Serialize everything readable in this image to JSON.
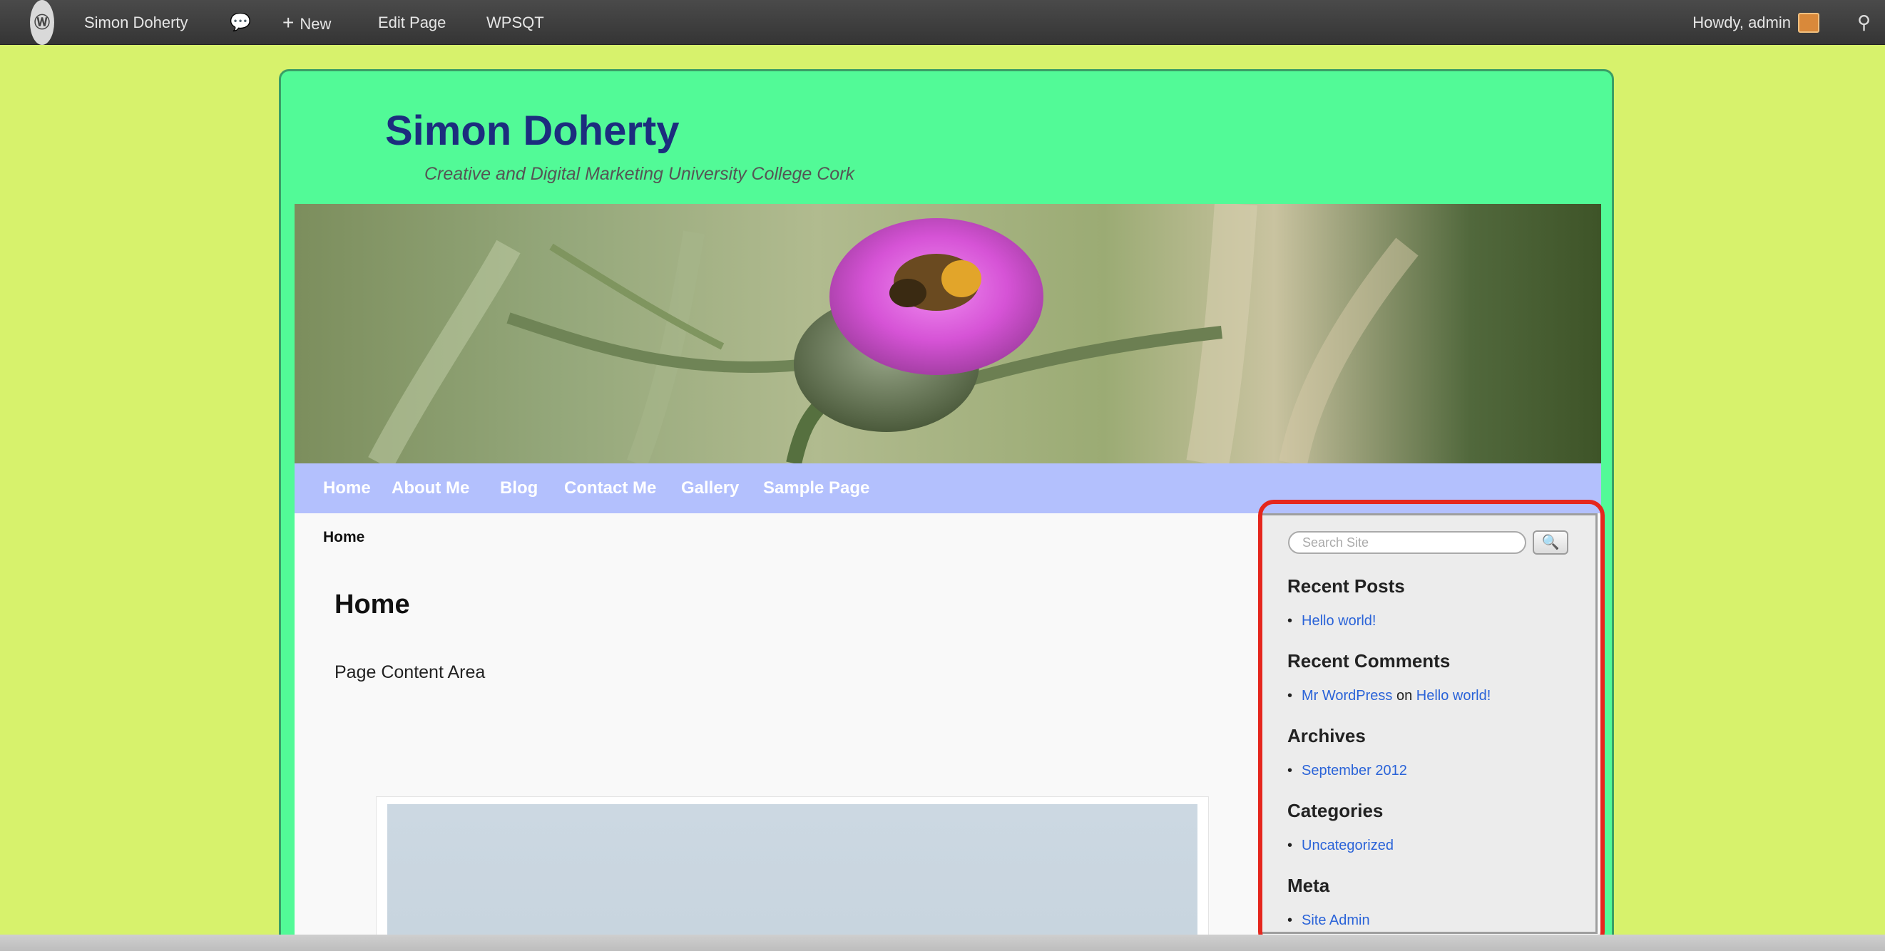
{
  "admin_bar": {
    "logo": "Ⓦ",
    "site_name": "Simon Doherty",
    "comments_icon": "💬",
    "new_label": "New",
    "new_plus": "+",
    "edit_page": "Edit Page",
    "plugin": "WPSQT",
    "howdy": "Howdy, admin",
    "search_icon": "⚲"
  },
  "site": {
    "title": "Simon Doherty",
    "description": "Creative and Digital Marketing University College Cork"
  },
  "nav": {
    "items": [
      "Home",
      "About Me",
      "Blog",
      "Contact Me",
      "Gallery",
      "Sample Page"
    ]
  },
  "content": {
    "breadcrumb": "Home",
    "page_title": "Home",
    "page_text": "Page Content Area"
  },
  "sidebar": {
    "search_placeholder": "Search Site",
    "search_button_icon": "🔍",
    "widgets": {
      "recent_posts": {
        "title": "Recent Posts",
        "item": "Hello world!"
      },
      "recent_comments": {
        "title": "Recent Comments",
        "author": "Mr WordPress",
        "on": "on",
        "post": "Hello world!"
      },
      "archives": {
        "title": "Archives",
        "item": "September 2012"
      },
      "categories": {
        "title": "Categories",
        "item": "Uncategorized"
      },
      "meta": {
        "title": "Meta",
        "item": "Site Admin"
      }
    },
    "bullet": "•"
  },
  "colors": {
    "page_background": "#d7f26c",
    "wrapper_background": "#52fa97",
    "nav_background": "#b3c0fd",
    "site_title": "#1c2d7e",
    "link": "#2a63d8",
    "highlight_border": "#e5261d"
  }
}
